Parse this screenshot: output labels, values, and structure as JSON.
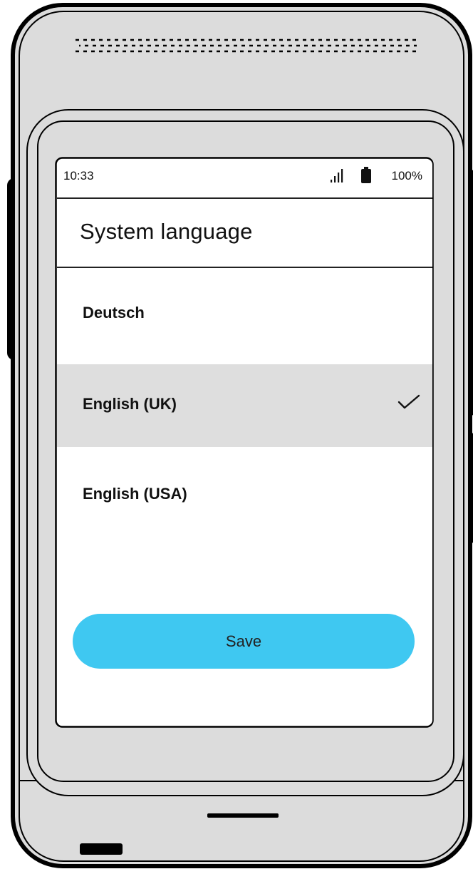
{
  "status_bar": {
    "time": "10:33",
    "signal_icon": "signal-icon",
    "battery_icon": "battery-icon",
    "battery_percent": "100%"
  },
  "page": {
    "title": "System language"
  },
  "languages": [
    {
      "label": "Deutsch",
      "selected": false
    },
    {
      "label": "English (UK)",
      "selected": true
    },
    {
      "label": "English (USA)",
      "selected": false
    }
  ],
  "selected_indicator_icon": "checkmark-icon",
  "save_button": {
    "label": "Save"
  },
  "colors": {
    "accent": "#3fc8f1",
    "selected_row": "#dedede",
    "device_body": "#dcdcdc",
    "outline": "#000000"
  }
}
